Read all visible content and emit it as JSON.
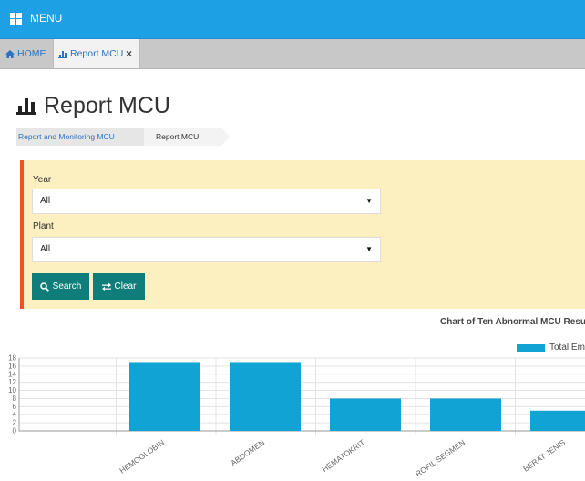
{
  "topbar": {
    "menu_label": "MENU"
  },
  "tabs": [
    {
      "label": "HOME",
      "icon": "home-icon"
    },
    {
      "label": "Report MCU",
      "icon": "bar-chart-icon",
      "close": "×"
    }
  ],
  "page": {
    "title": "Report MCU",
    "breadcrumb": [
      "Report and Monitoring MCU",
      "Report MCU"
    ]
  },
  "filters": {
    "year": {
      "label": "Year",
      "value": "All"
    },
    "plant": {
      "label": "Plant",
      "value": "All"
    },
    "search_label": "Search",
    "clear_label": "Clear"
  },
  "colors": {
    "topbar": "#1da1e4",
    "panel": "#fcefc0",
    "panel_accent": "#f1521f",
    "button": "#0f7d79",
    "bar": "#11a3d3"
  },
  "chart_data": {
    "type": "bar",
    "title": "Chart of Ten Abnormal MCU Resu",
    "legend_label": "Total Em",
    "categories": [
      "HEMOGLOBIN",
      "ABDOMEN",
      "HEMATOKRIT",
      "ROFIL SEGMEN",
      "BERAT JENIS"
    ],
    "values": [
      17,
      17,
      8,
      8,
      5
    ],
    "y_ticks": [
      0,
      2,
      4,
      6,
      8,
      10,
      12,
      14,
      16,
      18
    ],
    "ylim": [
      0,
      18
    ],
    "grid": true
  }
}
